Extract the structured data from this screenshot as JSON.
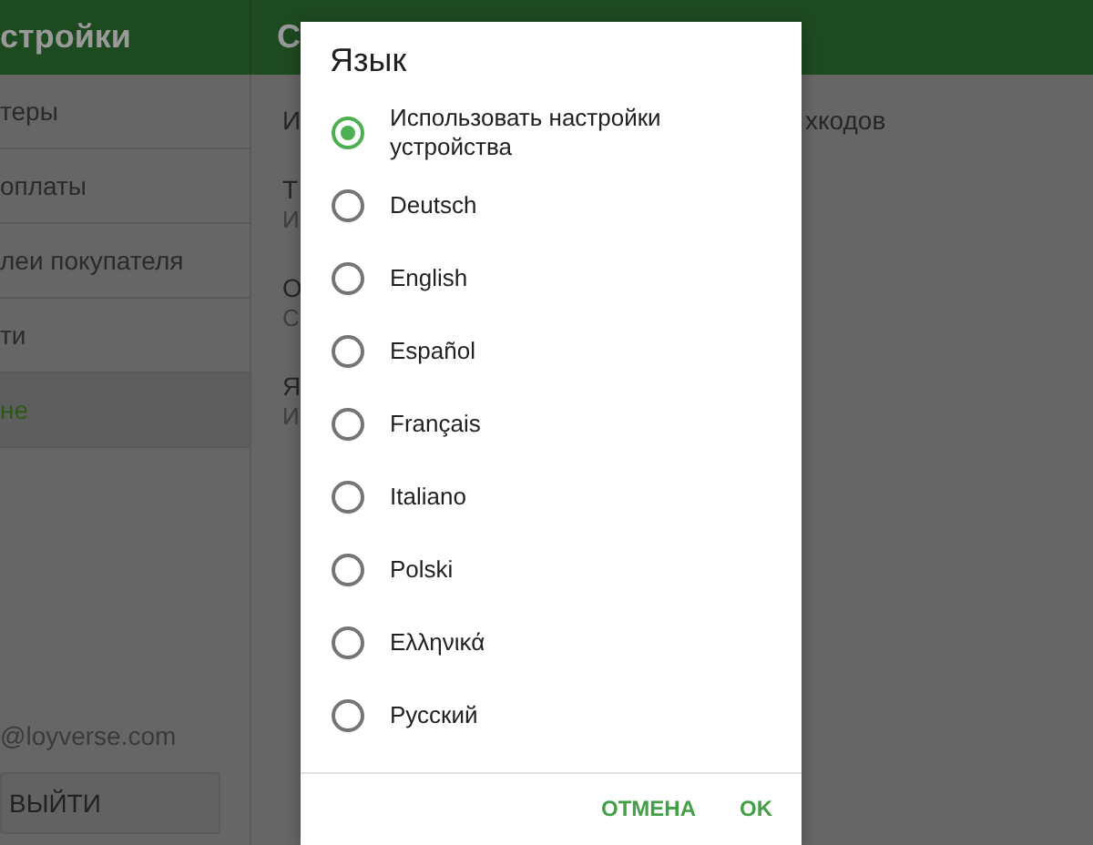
{
  "header": {
    "title": "стройки",
    "section_title": "С"
  },
  "sidebar": {
    "items": [
      {
        "label": "теры",
        "selected": false
      },
      {
        "label": "оплаты",
        "selected": false
      },
      {
        "label": "леи покупателя",
        "selected": false
      },
      {
        "label": "ти",
        "selected": false
      },
      {
        "label": "не",
        "selected": true
      }
    ],
    "account_email": "@loyverse.com",
    "logout_button": "ВЫЙТИ"
  },
  "settings": [
    {
      "title": "И",
      "title_end": "хкодов"
    },
    {
      "title": "Т",
      "subtitle": "И"
    },
    {
      "title": "О",
      "subtitle": "С"
    },
    {
      "title": "Я",
      "subtitle": "И"
    }
  ],
  "dialog": {
    "title": "Язык",
    "options": [
      {
        "label": "Использовать настройки устройства",
        "selected": true
      },
      {
        "label": "Deutsch",
        "selected": false
      },
      {
        "label": "English",
        "selected": false
      },
      {
        "label": "Español",
        "selected": false
      },
      {
        "label": "Français",
        "selected": false
      },
      {
        "label": "Italiano",
        "selected": false
      },
      {
        "label": "Polski",
        "selected": false
      },
      {
        "label": "Ελληνικά",
        "selected": false
      },
      {
        "label": "Русский",
        "selected": false
      }
    ],
    "buttons": [
      "ОТМЕНА",
      "OK"
    ]
  }
}
